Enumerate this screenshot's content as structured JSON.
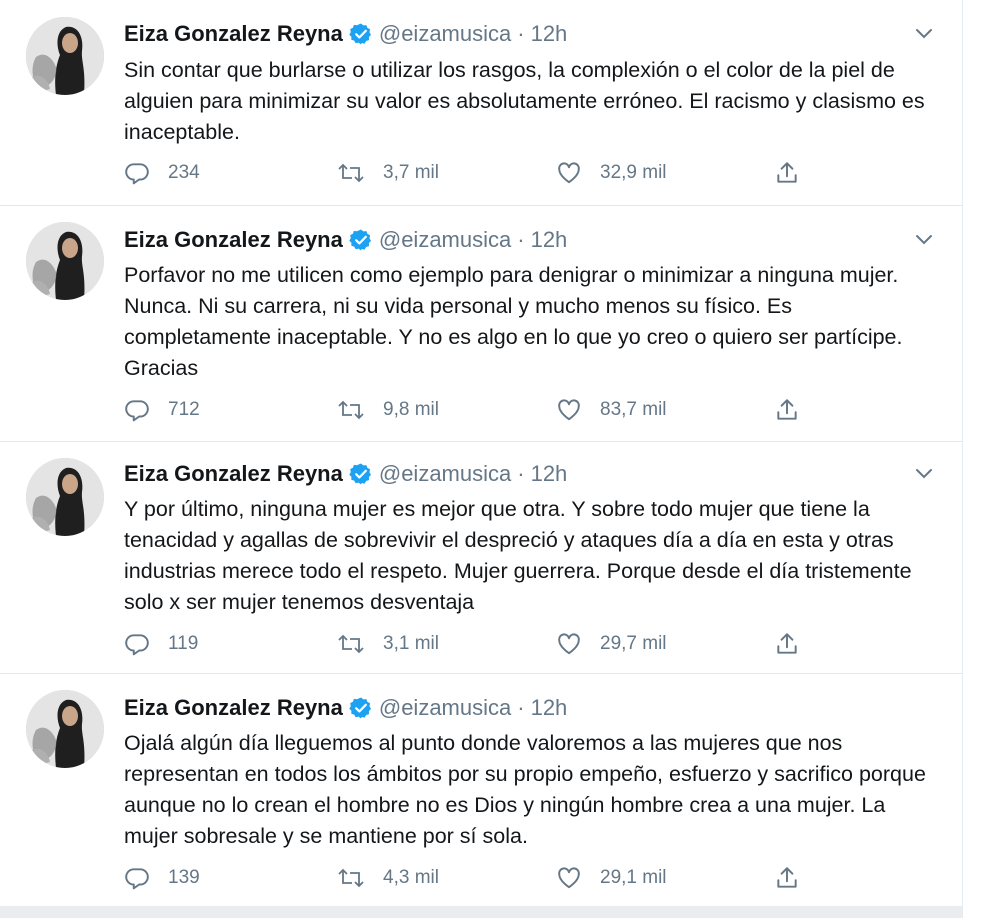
{
  "tweets": [
    {
      "name": "Eiza Gonzalez Reyna",
      "handle": "@eizamusica",
      "separator": "·",
      "time": "12h",
      "text": "Sin contar que burlarse o utilizar los rasgos, la complexión o el color de la piel de alguien para minimizar su valor es absolutamente erróneo. El racismo y clasismo es inaceptable.",
      "replies": "234",
      "retweets": "3,7 mil",
      "likes": "32,9 mil"
    },
    {
      "name": "Eiza Gonzalez Reyna",
      "handle": "@eizamusica",
      "separator": "·",
      "time": "12h",
      "text": "Porfavor no me utilicen como ejemplo para denigrar o minimizar a ninguna mujer. Nunca. Ni su carrera, ni su vida personal y mucho menos su físico. Es completamente inaceptable. Y no es algo en lo que yo creo o quiero ser partícipe. Gracias",
      "replies": "712",
      "retweets": "9,8 mil",
      "likes": "83,7 mil"
    },
    {
      "name": "Eiza Gonzalez Reyna",
      "handle": "@eizamusica",
      "separator": "·",
      "time": "12h",
      "text": "Y por último, ninguna mujer es mejor que otra. Y sobre todo mujer que tiene la tenacidad y agallas de sobrevivir el despreció y ataques día a día en esta y otras industrias merece todo el respeto. Mujer guerrera. Porque desde el día tristemente solo x ser mujer tenemos desventaja",
      "replies": "119",
      "retweets": "3,1 mil",
      "likes": "29,7 mil"
    },
    {
      "name": "Eiza Gonzalez Reyna",
      "handle": "@eizamusica",
      "separator": "·",
      "time": "12h",
      "text": "Ojalá algún día lleguemos al punto donde valoremos a las mujeres que nos representan en todos los ámbitos por su propio empeño, esfuerzo y sacrifico porque aunque no lo crean el hombre no es Dios y ningún hombre crea a una mujer. La mujer sobresale y se mantiene por sí sola.",
      "replies": "139",
      "retweets": "4,3 mil",
      "likes": "29,1 mil"
    }
  ],
  "icons": {
    "verified": "verified-badge-icon",
    "caret": "chevron-down-icon",
    "reply": "reply-icon",
    "retweet": "retweet-icon",
    "like": "heart-icon",
    "share": "share-icon"
  },
  "colors": {
    "verified_blue": "#1da1f2",
    "muted_text": "#657786",
    "divider": "#e1e8ed"
  }
}
